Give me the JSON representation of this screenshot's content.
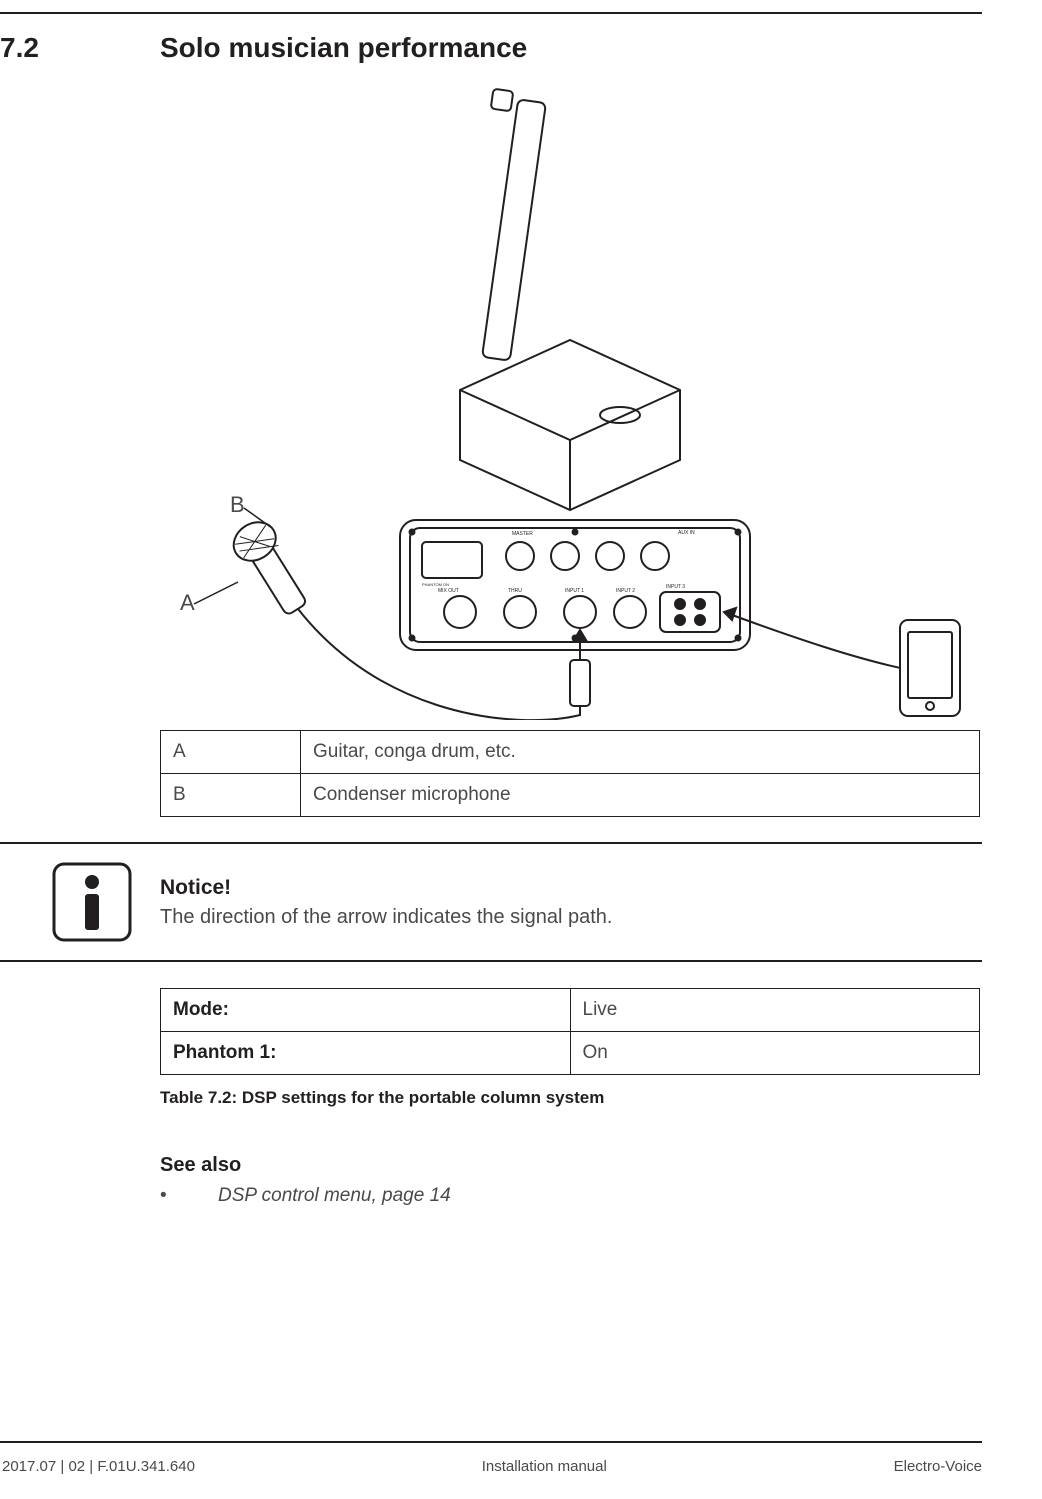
{
  "section": {
    "number": "7.2",
    "title": "Solo musician performance"
  },
  "diagram": {
    "label_a": "A",
    "label_b": "B",
    "panel": {
      "aux_in": "AUX IN",
      "input1": "INPUT 1",
      "input2": "INPUT 2",
      "input3": "INPUT 3",
      "thru": "THRU",
      "mix_out": "MIX OUT",
      "phantom": "PHANTOM ON"
    }
  },
  "legend": {
    "rows": [
      {
        "key": "A",
        "value": "Guitar, conga drum, etc."
      },
      {
        "key": "B",
        "value": "Condenser microphone"
      }
    ]
  },
  "notice": {
    "title": "Notice!",
    "text": "The direction of the arrow indicates the signal path."
  },
  "dsp": {
    "rows": [
      {
        "key": "Mode:",
        "value": "Live"
      },
      {
        "key": "Phantom 1:",
        "value": "On"
      }
    ],
    "caption": "Table 7.2: DSP settings for the portable column system"
  },
  "see_also": {
    "title": "See also",
    "items": [
      "DSP control menu, page 14"
    ]
  },
  "footer": {
    "left": "2017.07 | 02 | F.01U.341.640",
    "center": "Installation manual",
    "right": "Electro-Voice"
  }
}
